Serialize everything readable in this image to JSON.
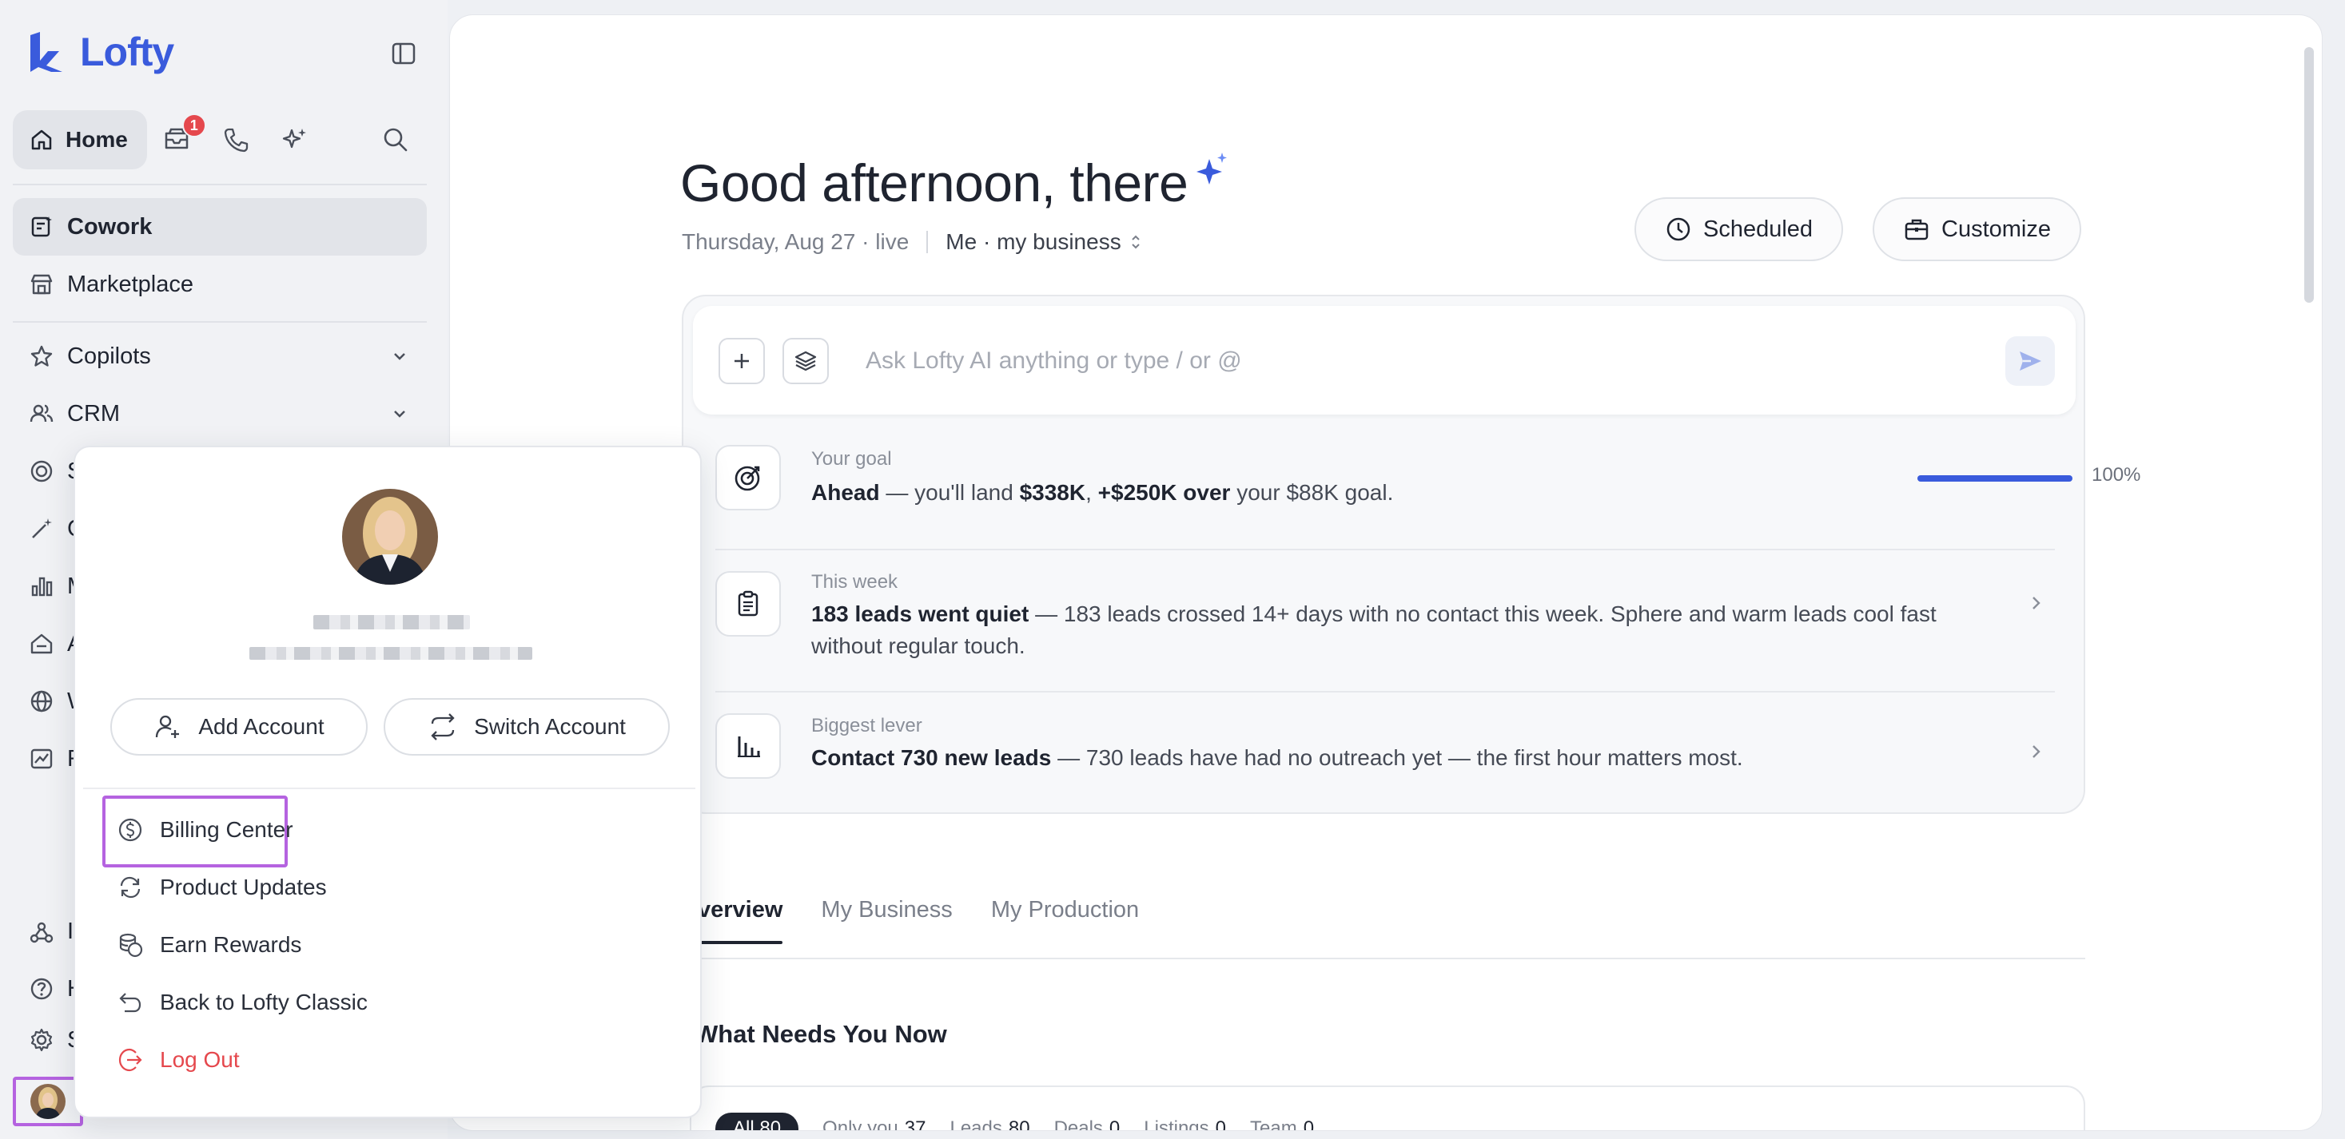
{
  "app": {
    "brand": "Lofty",
    "accent": "#3a5bdc",
    "highlight": "#b563e0",
    "danger": "#e5484d"
  },
  "topnav": {
    "home_label": "Home",
    "inbox_badge": "1"
  },
  "sidebar": {
    "items": [
      {
        "label": "Cowork",
        "icon": "cowork-icon",
        "active": true
      },
      {
        "label": "Marketplace",
        "icon": "marketplace-icon"
      },
      {
        "label": "Copilots",
        "icon": "star-icon"
      },
      {
        "label": "CRM",
        "icon": "people-icon"
      }
    ],
    "partial_items": [
      "S",
      "C",
      "M",
      "A",
      "W",
      "R"
    ],
    "bottom_partial": [
      "I",
      "H",
      "S"
    ]
  },
  "main": {
    "greeting": "Good afternoon, there",
    "date_line": "Thursday, Aug 27 · live",
    "scope": "Me · my business",
    "scheduled_label": "Scheduled",
    "customize_label": "Customize",
    "ask_placeholder": "Ask Lofty AI anything or type / or @",
    "insights": [
      {
        "label": "Your goal",
        "t1": "Ahead",
        "t2": " — you'll land ",
        "t3": "$338K",
        "t4": ", ",
        "t5": "+$250K over",
        "t6": " your $88K goal.",
        "progress": 1.0,
        "progress_text": "100%"
      },
      {
        "label": "This week",
        "bold": "183 leads went quiet",
        "rest": " — 183 leads crossed 14+ days with no contact this week. Sphere and warm leads cool fast without regular touch."
      },
      {
        "label": "Biggest lever",
        "bold": "Contact 730 new leads",
        "rest": " — 730 leads have had no outreach yet — the first hour matters most."
      }
    ],
    "tabs": [
      "verview",
      "My Business",
      "My Production"
    ],
    "needs_title": "What Needs You Now",
    "filters": [
      {
        "label": "All",
        "count": "80",
        "active": true
      },
      {
        "label": "Only you",
        "count": "37"
      },
      {
        "label": "Leads",
        "count": "80"
      },
      {
        "label": "Deals",
        "count": "0"
      },
      {
        "label": "Listings",
        "count": "0"
      },
      {
        "label": "Team",
        "count": "0"
      }
    ]
  },
  "popup": {
    "add_account": "Add Account",
    "switch_account": "Switch Account",
    "menu": [
      {
        "label": "Billing Center",
        "icon": "dollar-circle-icon"
      },
      {
        "label": "Product Updates",
        "icon": "refresh-icon"
      },
      {
        "label": "Earn Rewards",
        "icon": "coins-icon"
      },
      {
        "label": "Back to Lofty Classic",
        "icon": "back-arrow-icon"
      },
      {
        "label": "Log Out",
        "icon": "logout-icon"
      }
    ]
  }
}
